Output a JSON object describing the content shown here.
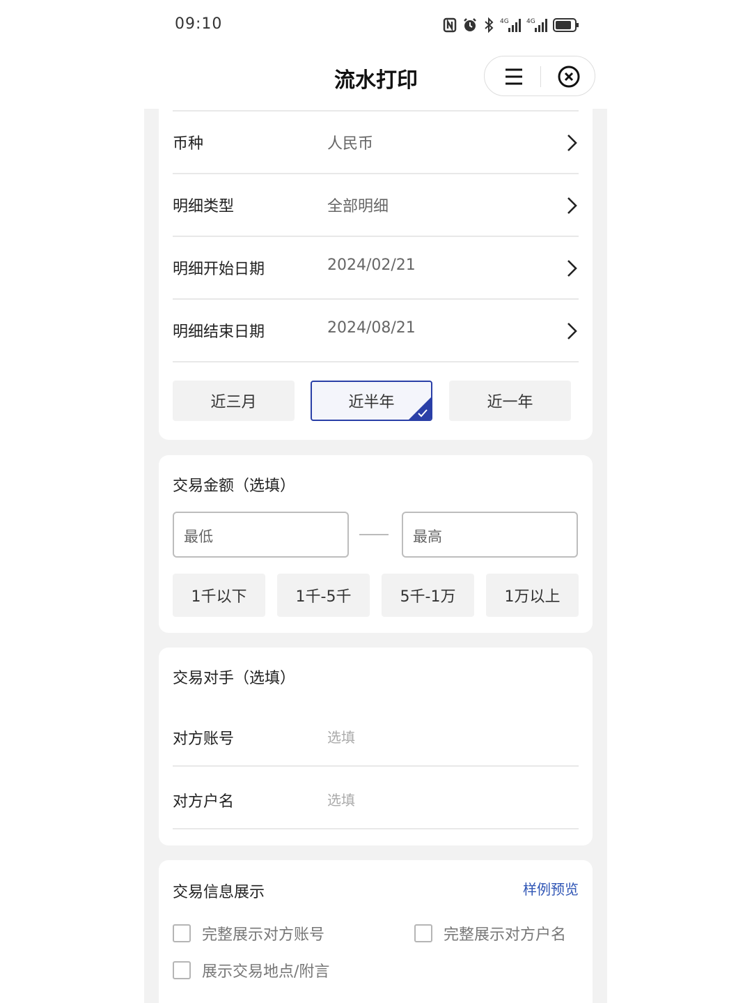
{
  "status": {
    "time": "09:10",
    "icons": [
      "nfc-icon",
      "alarm-icon",
      "bluetooth-icon",
      "signal-4g-icon",
      "signal-4g-icon",
      "battery-icon"
    ],
    "net1": "4G",
    "net2": "4G"
  },
  "nav": {
    "title": "流水打印",
    "menu_icon": "menu-icon",
    "close_icon": "close-circle-icon"
  },
  "detail_rows": [
    {
      "label": "币种",
      "value": "人民币"
    },
    {
      "label": "明细类型",
      "value": "全部明细"
    },
    {
      "label": "明细开始日期",
      "value": "2024/02/21"
    },
    {
      "label": "明细结束日期",
      "value": "2024/08/21"
    }
  ],
  "period_options": {
    "items": [
      "近三月",
      "近半年",
      "近一年"
    ],
    "selected": "近半年",
    "accent": "#2a3fa7"
  },
  "amount": {
    "title": "交易金额（选填）",
    "min_placeholder": "最低",
    "max_placeholder": "最高",
    "ranges": [
      "1千以下",
      "1千-5千",
      "5千-1万",
      "1万以上"
    ]
  },
  "counterparty": {
    "title": "交易对手（选填）",
    "rows": [
      {
        "label": "对方账号",
        "placeholder": "选填"
      },
      {
        "label": "对方户名",
        "placeholder": "选填"
      }
    ]
  },
  "display": {
    "title": "交易信息展示",
    "preview_link": "样例预览",
    "link_color": "#2f55b5",
    "options": [
      {
        "label": "完整展示对方账号",
        "checked": false
      },
      {
        "label": "完整展示对方户名",
        "checked": false
      },
      {
        "label": "展示交易地点/附言",
        "checked": false
      }
    ]
  }
}
